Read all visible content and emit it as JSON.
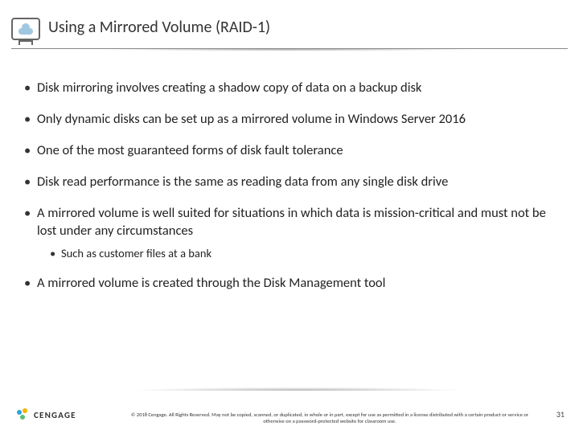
{
  "header": {
    "title": "Using a Mirrored Volume (RAID-1)",
    "icon": "cloud-monitor-icon"
  },
  "bullets": [
    {
      "text": "Disk mirroring involves creating a shadow copy of data on a backup disk"
    },
    {
      "text": "Only dynamic disks can be set up as a mirrored volume in Windows Server 2016"
    },
    {
      "text": "One of the most guaranteed forms of disk fault tolerance"
    },
    {
      "text": "Disk read performance is the same as reading data from any single disk drive"
    },
    {
      "text": "A mirrored volume is well suited for situations in which data is mission-critical and must not be lost under any circumstances",
      "sub": [
        {
          "text": "Such as customer files at a bank"
        }
      ]
    },
    {
      "text": "A mirrored volume is created through the Disk Management tool"
    }
  ],
  "footer": {
    "brand": "CENGAGE",
    "copyright": "© 2018 Cengage. All Rights Reserved. May not be copied, scanned, or duplicated, in whole or in part, except for use as permitted in a license distributed with a certain product or service or otherwise on a password-protected website for classroom use.",
    "page_number": "31"
  }
}
